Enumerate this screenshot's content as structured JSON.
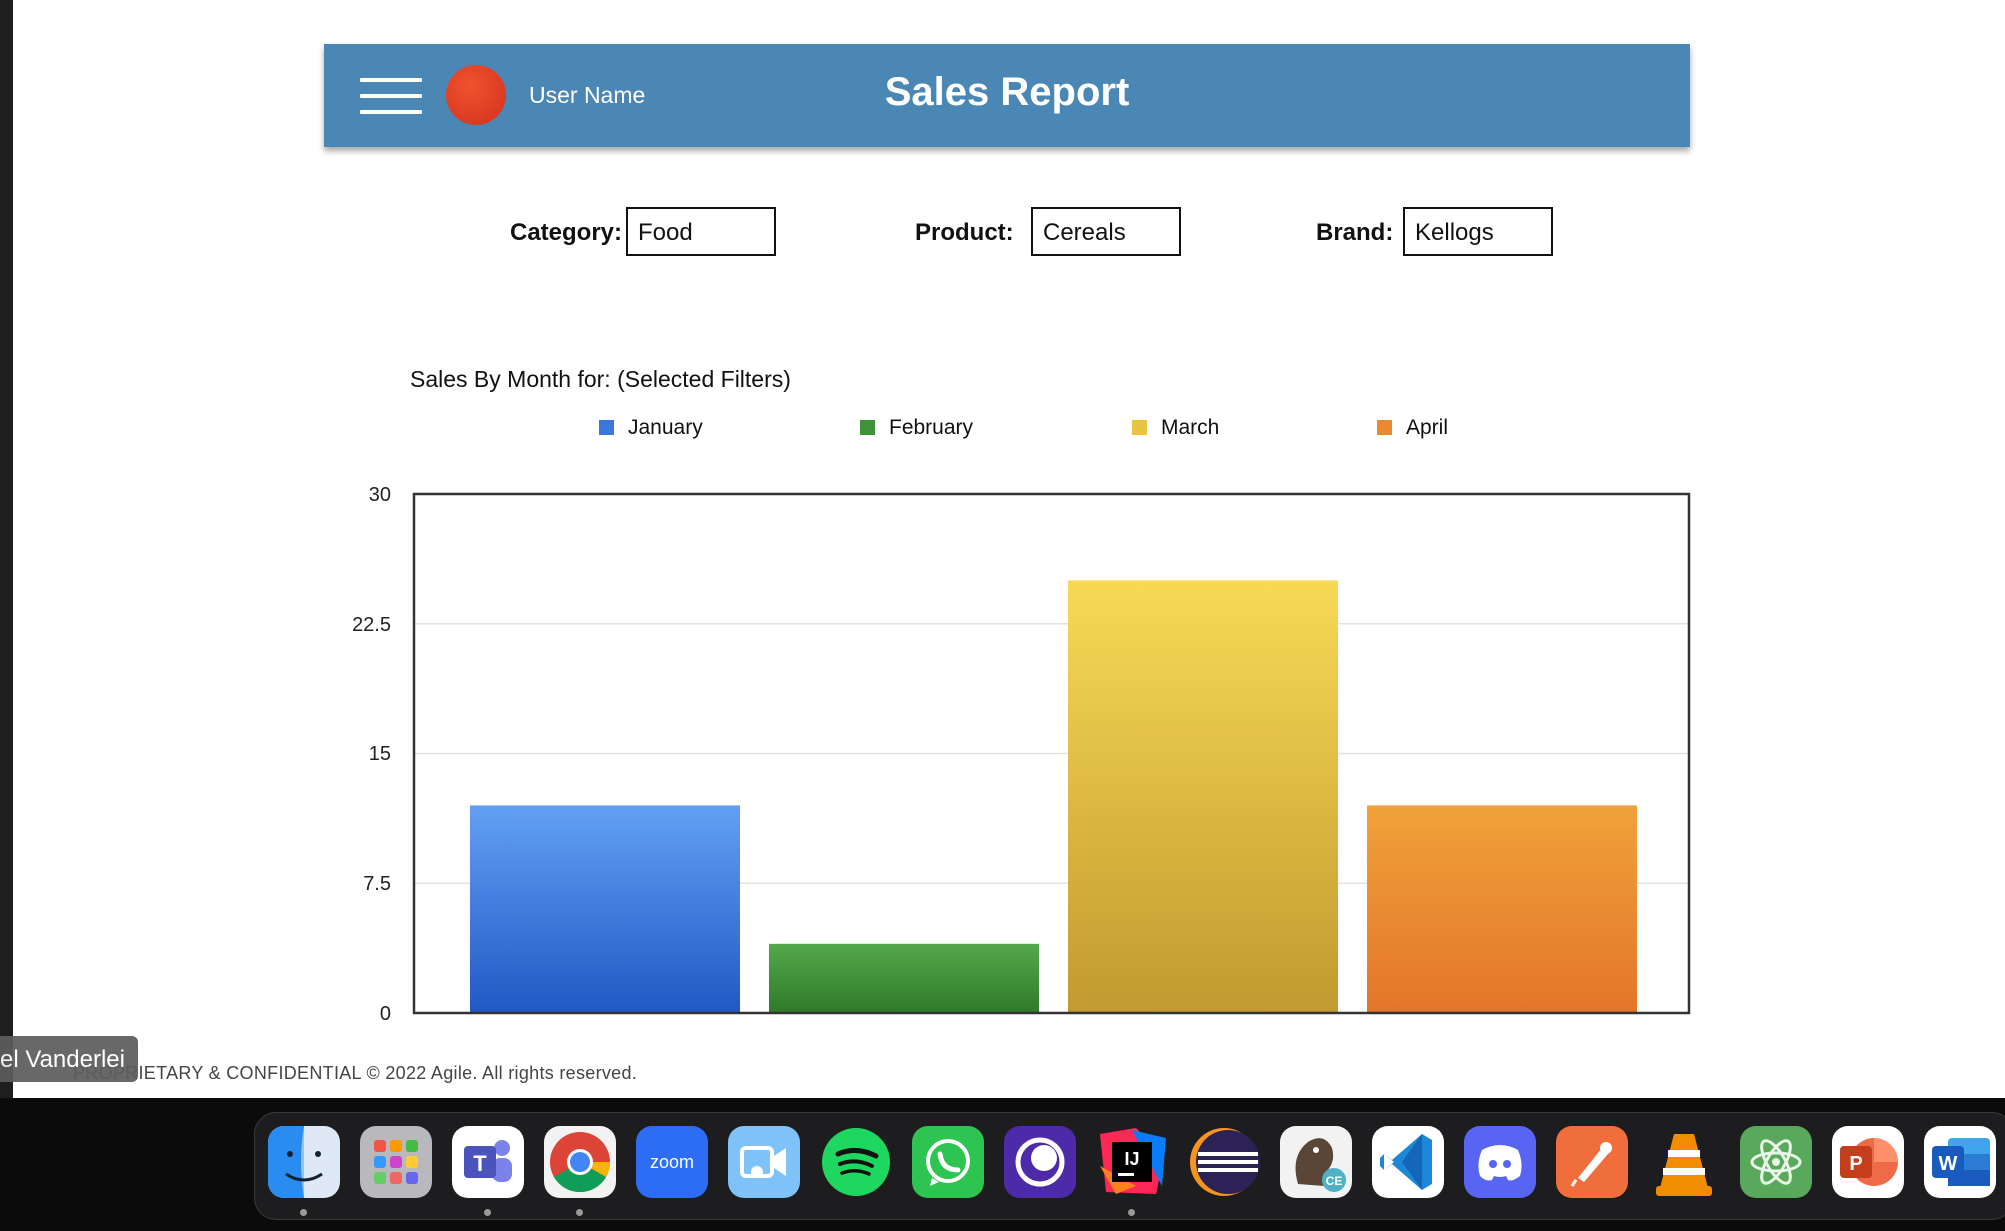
{
  "header": {
    "user_name": "User Name",
    "title": "Sales Report"
  },
  "filters": {
    "category_label": "Category:",
    "category_value": "Food",
    "product_label": "Product:",
    "product_value": "Cereals",
    "brand_label": "Brand:",
    "brand_value": "Kellogs"
  },
  "chart_data": {
    "type": "bar",
    "title": "Sales By Month for:  (Selected Filters)",
    "categories": [
      "January",
      "February",
      "March",
      "April"
    ],
    "values": [
      12,
      4,
      25,
      12
    ],
    "colors": [
      "#3b78dc",
      "#3f9238",
      "#e9c43e",
      "#ea8a2f"
    ],
    "yticks": [
      "30",
      "22.5",
      "15",
      "7.5",
      "0"
    ],
    "ylim": [
      0,
      30
    ],
    "grid": true,
    "legend_position": "top"
  },
  "footer": {
    "text": "PROPRIETARY & CONFIDENTIAL © 2022 Agile. All rights reserved."
  },
  "overlay": {
    "participant_name": "el Vanderlei"
  },
  "dock": {
    "apps": [
      "finder-icon",
      "launchpad-icon",
      "teams-icon",
      "chrome-icon",
      "zoom-icon",
      "facetime-icon",
      "spotify-icon",
      "whatsapp-icon",
      "screen-recorder-icon",
      "intellij-icon",
      "eclipse-icon",
      "dbeaver-icon",
      "vscode-icon",
      "discord-icon",
      "postman-icon",
      "vlc-icon",
      "atom-icon",
      "powerpoint-icon",
      "word-icon"
    ],
    "zoom_label": "zoom",
    "intellij_label": "IJ",
    "dbeaver_label": "CE",
    "powerpoint_label": "P",
    "word_label": "W"
  }
}
